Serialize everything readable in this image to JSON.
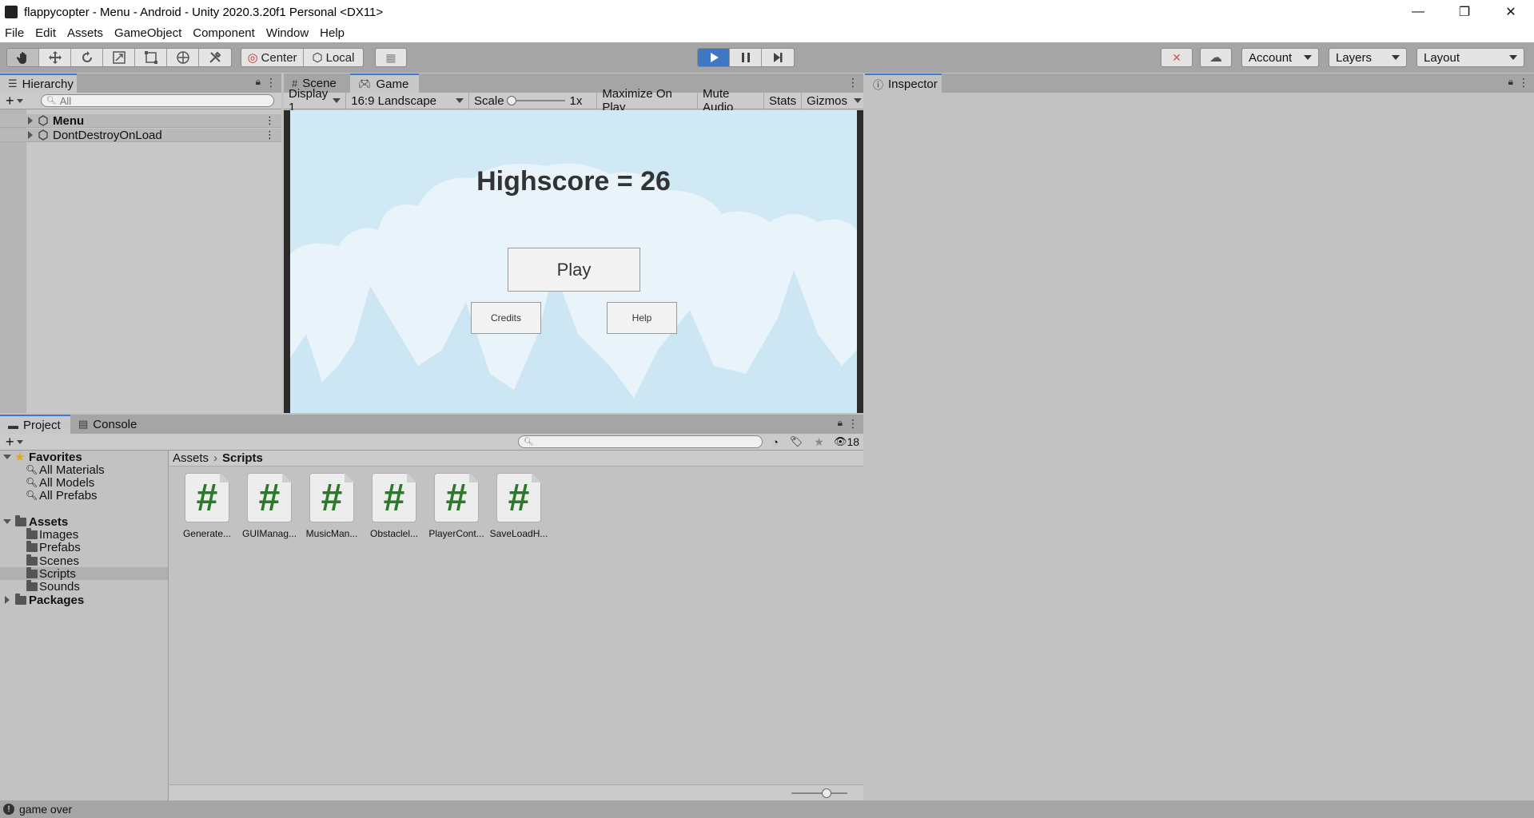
{
  "window": {
    "title": "flappycopter - Menu - Android - Unity 2020.3.20f1 Personal <DX11>",
    "minimize": "—",
    "maximize": "❐",
    "close": "✕"
  },
  "menu": [
    "File",
    "Edit",
    "Assets",
    "GameObject",
    "Component",
    "Window",
    "Help"
  ],
  "toolbar": {
    "pivot_center": "Center",
    "pivot_local": "Local",
    "account": "Account",
    "layers": "Layers",
    "layout": "Layout"
  },
  "hierarchy": {
    "tab": "Hierarchy",
    "search_placeholder": "All",
    "items": [
      "Menu",
      "DontDestroyOnLoad"
    ]
  },
  "game": {
    "tabs": [
      "Scene",
      "Game"
    ],
    "display": "Display 1",
    "aspect": "16:9 Landscape",
    "scale_label": "Scale",
    "scale_value": "1x",
    "maximize": "Maximize On Play",
    "mute": "Mute Audio",
    "stats": "Stats",
    "gizmos": "Gizmos",
    "highscore": "Highscore = 26",
    "play": "Play",
    "credits": "Credits",
    "help": "Help"
  },
  "inspector": {
    "tab": "Inspector"
  },
  "project": {
    "tabs": [
      "Project",
      "Console"
    ],
    "hidden_count": "18",
    "favorites": {
      "label": "Favorites",
      "items": [
        "All Materials",
        "All Models",
        "All Prefabs"
      ]
    },
    "assets": {
      "label": "Assets",
      "folders": [
        "Images",
        "Prefabs",
        "Scenes",
        "Scripts",
        "Sounds"
      ]
    },
    "packages": "Packages",
    "breadcrumb": [
      "Assets",
      "Scripts"
    ],
    "files": [
      "Generate...",
      "GUIManag...",
      "MusicMan...",
      "Obstaclel...",
      "PlayerCont...",
      "SaveLoadH..."
    ]
  },
  "status": {
    "message": "game over"
  },
  "colors": {
    "accent": "#3e77c4",
    "script_icon": "#2a7a2a",
    "sky": "#d1e9f5"
  }
}
